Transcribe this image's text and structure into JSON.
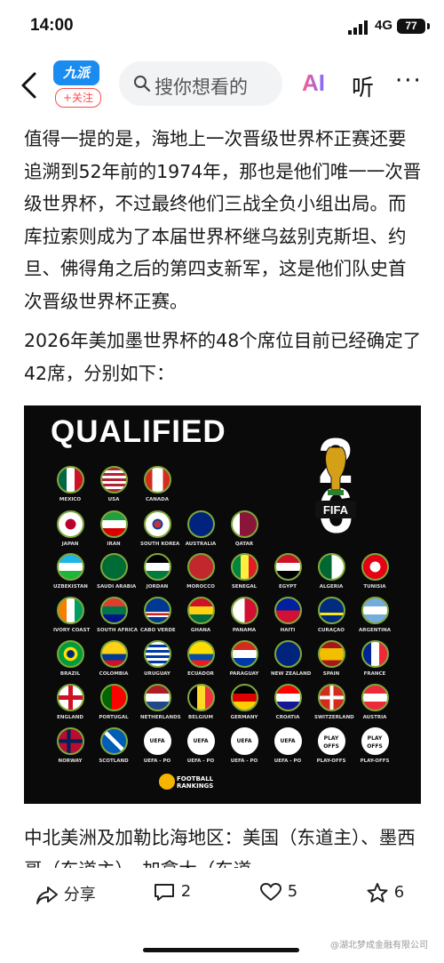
{
  "status_bar": {
    "time": "14:00",
    "network": "4G",
    "battery": "77"
  },
  "nav": {
    "logo": "九派",
    "follow_label": "+关注",
    "search_placeholder": "搜你想看的",
    "ai_label": "AI",
    "listen_label": "听",
    "more_label": "···"
  },
  "article": {
    "paragraph1": "值得一提的是，海地上一次晋级世界杯正赛还要追溯到52年前的1974年，那也是他们唯一一次晋级世界杯，不过最终他们三战全负小组出局。而库拉索则成为了本届世界杯继乌兹别克斯坦、约旦、佛得角之后的第四支新军，这是他们队史首次晋级世界杯正赛。",
    "paragraph2": "2026年美加墨世界杯的48个席位目前已经确定了42席，分别如下：",
    "paragraph3": "中北美洲及加勒比海地区：美国（东道主）、墨西哥（东道主）、加拿大（东道"
  },
  "poster": {
    "title": "QUALIFIED",
    "fifa_label": "FIFA",
    "rows": [
      [
        "MEXICO",
        "USA",
        "CANADA"
      ],
      [
        "JAPAN",
        "IRAN",
        "SOUTH KOREA",
        "AUSTRALIA",
        "QATAR"
      ],
      [
        "UZBEKISTAN",
        "SAUDI ARABIA",
        "JORDAN",
        "MOROCCO",
        "SENEGAL",
        "EGYPT",
        "ALGERIA",
        "TUNISIA"
      ],
      [
        "IVORY COAST",
        "SOUTH AFRICA",
        "CABO VERDE",
        "GHANA",
        "PANAMA",
        "HAITI",
        "CURAÇAO",
        "ARGENTINA"
      ],
      [
        "BRAZIL",
        "COLOMBIA",
        "URUGUAY",
        "ECUADOR",
        "PARAGUAY",
        "NEW ZEALAND",
        "SPAIN",
        "FRANCE"
      ],
      [
        "ENGLAND",
        "PORTUGAL",
        "NETHERLANDS",
        "BELGIUM",
        "GERMANY",
        "CROATIA",
        "SWITZERLAND",
        "AUSTRIA"
      ],
      [
        "NORWAY",
        "SCOTLAND",
        "UEFA - PO",
        "UEFA - PO",
        "UEFA - PO",
        "UEFA - PO",
        "PLAY-OFFS",
        "PLAY-OFFS"
      ]
    ],
    "uefa_badge": "UEFA",
    "playoffs_badge": "PLAY OFFS",
    "credit_line1": "FOOTBALL",
    "credit_line2": "RANKINGS"
  },
  "bottom_bar": {
    "share_label": "分享",
    "comments": "2",
    "likes": "5",
    "favorites": "6"
  },
  "watermark": "@湖北梦成金融有限公司"
}
